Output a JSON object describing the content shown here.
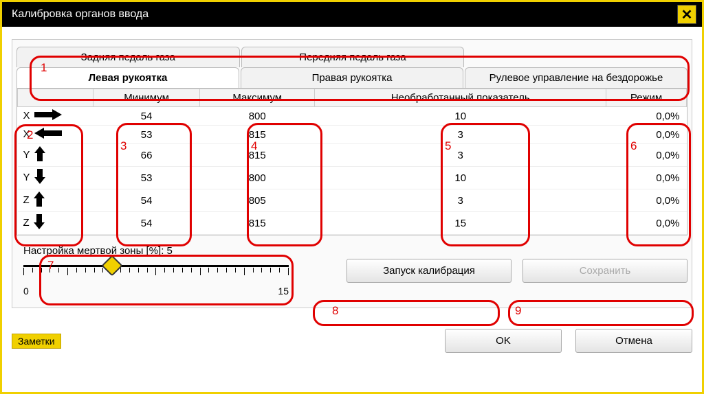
{
  "title": "Калибровка органов ввода",
  "tabs_top": [
    "Задняя педаль газа",
    "Передняя педаль газа",
    ""
  ],
  "tabs_bottom": [
    "Левая рукоятка",
    "Правая рукоятка",
    "Рулевое управление на бездорожье"
  ],
  "active_tab": "Левая рукоятка",
  "columns": {
    "axis": "",
    "min": "Минимум",
    "max": "Максимум",
    "raw": "Необработанный показатель",
    "mode": "Режим"
  },
  "rows": [
    {
      "axis": "X",
      "dir": "right",
      "min": "54",
      "max": "800",
      "raw": "10",
      "mode": "0,0%"
    },
    {
      "axis": "X",
      "dir": "left",
      "min": "53",
      "max": "815",
      "raw": "3",
      "mode": "0,0%"
    },
    {
      "axis": "Y",
      "dir": "up",
      "min": "66",
      "max": "815",
      "raw": "3",
      "mode": "0,0%"
    },
    {
      "axis": "Y",
      "dir": "down",
      "min": "53",
      "max": "800",
      "raw": "10",
      "mode": "0,0%"
    },
    {
      "axis": "Z",
      "dir": "up",
      "min": "54",
      "max": "805",
      "raw": "3",
      "mode": "0,0%"
    },
    {
      "axis": "Z",
      "dir": "down",
      "min": "54",
      "max": "815",
      "raw": "15",
      "mode": "0,0%"
    }
  ],
  "deadzone": {
    "label_prefix": "Настройка мертвой зоны [%]: ",
    "value": "5",
    "min": "0",
    "max": "15"
  },
  "buttons": {
    "start_calib": "Запуск калибрация",
    "save": "Сохранить",
    "ok": "OK",
    "cancel": "Отмена"
  },
  "notes": "Заметки",
  "annotations": [
    "1",
    "2",
    "3",
    "4",
    "5",
    "6",
    "7",
    "8",
    "9"
  ]
}
